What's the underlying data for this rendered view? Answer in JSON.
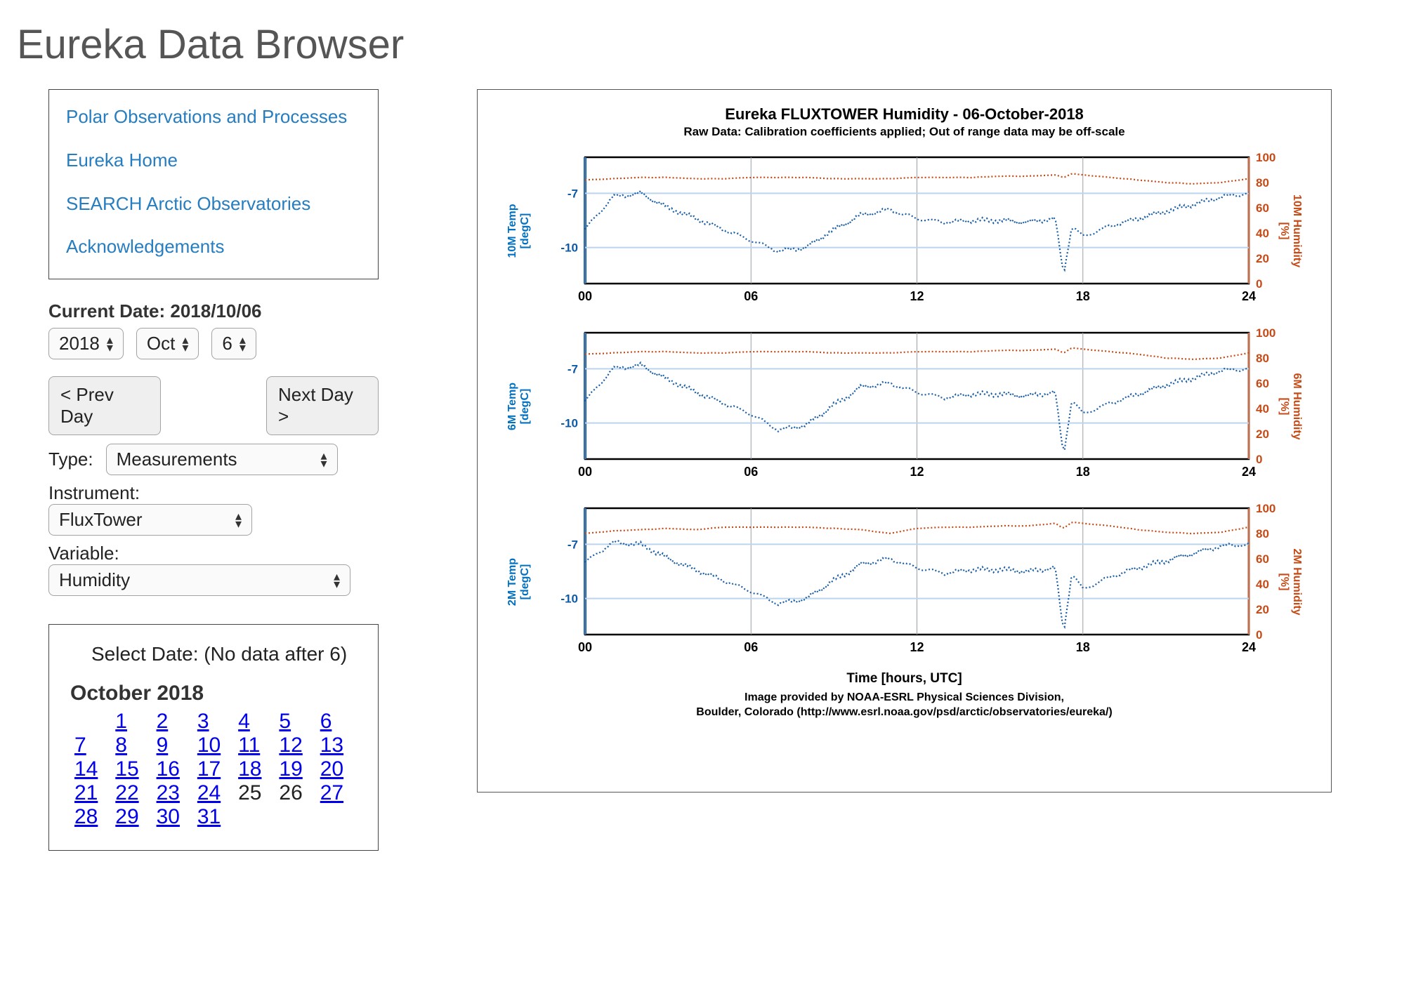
{
  "page_title": "Eureka Data Browser",
  "nav": {
    "items": [
      "Polar Observations and Processes",
      "Eureka Home",
      "SEARCH Arctic Observatories",
      "Acknowledgements"
    ]
  },
  "controls": {
    "current_date_label": "Current Date:",
    "current_date_value": "2018/10/06",
    "year": "2018",
    "month": "Oct",
    "day": "6",
    "prev_day": "< Prev Day",
    "next_day": "Next Day >",
    "type_label": "Type:",
    "type_value": "Measurements",
    "instrument_label": "Instrument:",
    "instrument_value": "FluxTower",
    "variable_label": "Variable:",
    "variable_value": "Humidity"
  },
  "calendar": {
    "header": "Select Date: (No data after 6)",
    "month_title": "October 2018",
    "first_weekday_offset": 1,
    "days_in_month": 31,
    "nolink_days": [
      25,
      26
    ]
  },
  "chart": {
    "title": "Eureka FLUXTOWER Humidity - 06-October-2018",
    "subtitle": "Raw Data: Calibration coefficients applied; Out of range data may be off-scale",
    "xaxis_label": "Time [hours, UTC]",
    "credit_line1": "Image provided by NOAA-ESRL Physical Sciences Division,",
    "credit_line2": "Boulder, Colorado (http://www.esrl.noaa.gov/psd/arctic/observatories/eureka/)",
    "panels": [
      {
        "left_label_1": "10M Temp",
        "left_label_2": "[degC]",
        "right_label_1": "10M Humidity",
        "right_label_2": "[%]"
      },
      {
        "left_label_1": "6M Temp",
        "left_label_2": "[degC]",
        "right_label_1": "6M Humidity",
        "right_label_2": "[%]"
      },
      {
        "left_label_1": "2M Temp",
        "left_label_2": "[degC]",
        "right_label_1": "2M Humidity",
        "right_label_2": "[%]"
      }
    ]
  },
  "chart_data": [
    {
      "type": "line",
      "title": "10M Temp / 10M Humidity",
      "xlabel": "Time [hours, UTC]",
      "x_ticks": [
        "00",
        "06",
        "12",
        "18",
        "24"
      ],
      "x": [
        0,
        1,
        2,
        3,
        4,
        5,
        6,
        7,
        8,
        9,
        10,
        11,
        12,
        13,
        14,
        15,
        16,
        17,
        17.3,
        17.6,
        18,
        19,
        20,
        21,
        22,
        23,
        24
      ],
      "series": [
        {
          "name": "10M Temp [degC]",
          "axis": "left",
          "ylim": [
            -12,
            -5
          ],
          "ticks": [
            -10,
            -7
          ],
          "color": "#1b5fa6",
          "values": [
            -9.0,
            -7.2,
            -7.0,
            -7.8,
            -8.4,
            -9.0,
            -9.6,
            -10.2,
            -10.0,
            -9.0,
            -8.2,
            -7.9,
            -8.4,
            -8.6,
            -8.5,
            -8.5,
            -8.6,
            -8.4,
            -11.5,
            -8.8,
            -9.4,
            -8.8,
            -8.4,
            -8.0,
            -7.6,
            -7.2,
            -7.0
          ]
        },
        {
          "name": "10M Humidity [%]",
          "axis": "right",
          "ylim": [
            0,
            100
          ],
          "ticks": [
            0,
            20,
            40,
            60,
            80,
            100
          ],
          "color": "#c54a15",
          "values": [
            82,
            83,
            84,
            84,
            83,
            83,
            84,
            84,
            84,
            83,
            83,
            83,
            84,
            84,
            84,
            85,
            85,
            86,
            84,
            87,
            86,
            84,
            82,
            80,
            79,
            80,
            83
          ]
        }
      ]
    },
    {
      "type": "line",
      "title": "6M Temp / 6M Humidity",
      "xlabel": "Time [hours, UTC]",
      "x_ticks": [
        "00",
        "06",
        "12",
        "18",
        "24"
      ],
      "x": [
        0,
        1,
        2,
        3,
        4,
        5,
        6,
        7,
        8,
        9,
        10,
        11,
        12,
        13,
        14,
        15,
        16,
        17,
        17.3,
        17.6,
        18,
        19,
        20,
        21,
        22,
        23,
        24
      ],
      "series": [
        {
          "name": "6M Temp [degC]",
          "axis": "left",
          "ylim": [
            -12,
            -5
          ],
          "ticks": [
            -10,
            -7
          ],
          "color": "#1b5fa6",
          "values": [
            -8.8,
            -7.0,
            -6.8,
            -7.6,
            -8.3,
            -8.9,
            -9.5,
            -10.4,
            -10.1,
            -9.0,
            -8.0,
            -7.8,
            -8.3,
            -8.6,
            -8.4,
            -8.4,
            -8.5,
            -8.3,
            -11.8,
            -8.7,
            -9.5,
            -8.9,
            -8.4,
            -7.9,
            -7.5,
            -7.1,
            -7.0
          ]
        },
        {
          "name": "6M Humidity [%]",
          "axis": "right",
          "ylim": [
            0,
            100
          ],
          "ticks": [
            0,
            20,
            40,
            60,
            80,
            100
          ],
          "color": "#c54a15",
          "values": [
            83,
            84,
            85,
            85,
            84,
            84,
            85,
            85,
            85,
            84,
            84,
            84,
            85,
            85,
            85,
            86,
            86,
            87,
            84,
            88,
            87,
            85,
            83,
            80,
            79,
            80,
            84
          ]
        }
      ]
    },
    {
      "type": "line",
      "title": "2M Temp / 2M Humidity",
      "xlabel": "Time [hours, UTC]",
      "x_ticks": [
        "00",
        "06",
        "12",
        "18",
        "24"
      ],
      "x": [
        0,
        1,
        2,
        3,
        4,
        5,
        6,
        7,
        8,
        9,
        10,
        11,
        12,
        13,
        14,
        15,
        16,
        17,
        17.3,
        17.6,
        18,
        19,
        20,
        21,
        22,
        23,
        24
      ],
      "series": [
        {
          "name": "2M Temp [degC]",
          "axis": "left",
          "ylim": [
            -12,
            -5
          ],
          "ticks": [
            -10,
            -7
          ],
          "color": "#1b5fa6",
          "values": [
            -8.0,
            -6.9,
            -7.0,
            -7.8,
            -8.4,
            -9.0,
            -9.6,
            -10.3,
            -10.0,
            -9.0,
            -8.1,
            -7.8,
            -8.3,
            -8.6,
            -8.4,
            -8.4,
            -8.5,
            -8.3,
            -11.9,
            -8.6,
            -9.5,
            -8.8,
            -8.3,
            -7.9,
            -7.5,
            -7.1,
            -7.0
          ]
        },
        {
          "name": "2M Humidity [%]",
          "axis": "right",
          "ylim": [
            0,
            100
          ],
          "ticks": [
            0,
            20,
            40,
            60,
            80,
            100
          ],
          "color": "#c54a15",
          "values": [
            80,
            82,
            83,
            84,
            83,
            85,
            85,
            85,
            85,
            84,
            83,
            80,
            84,
            85,
            85,
            86,
            86,
            88,
            84,
            89,
            88,
            86,
            83,
            81,
            80,
            81,
            85
          ]
        }
      ]
    }
  ]
}
